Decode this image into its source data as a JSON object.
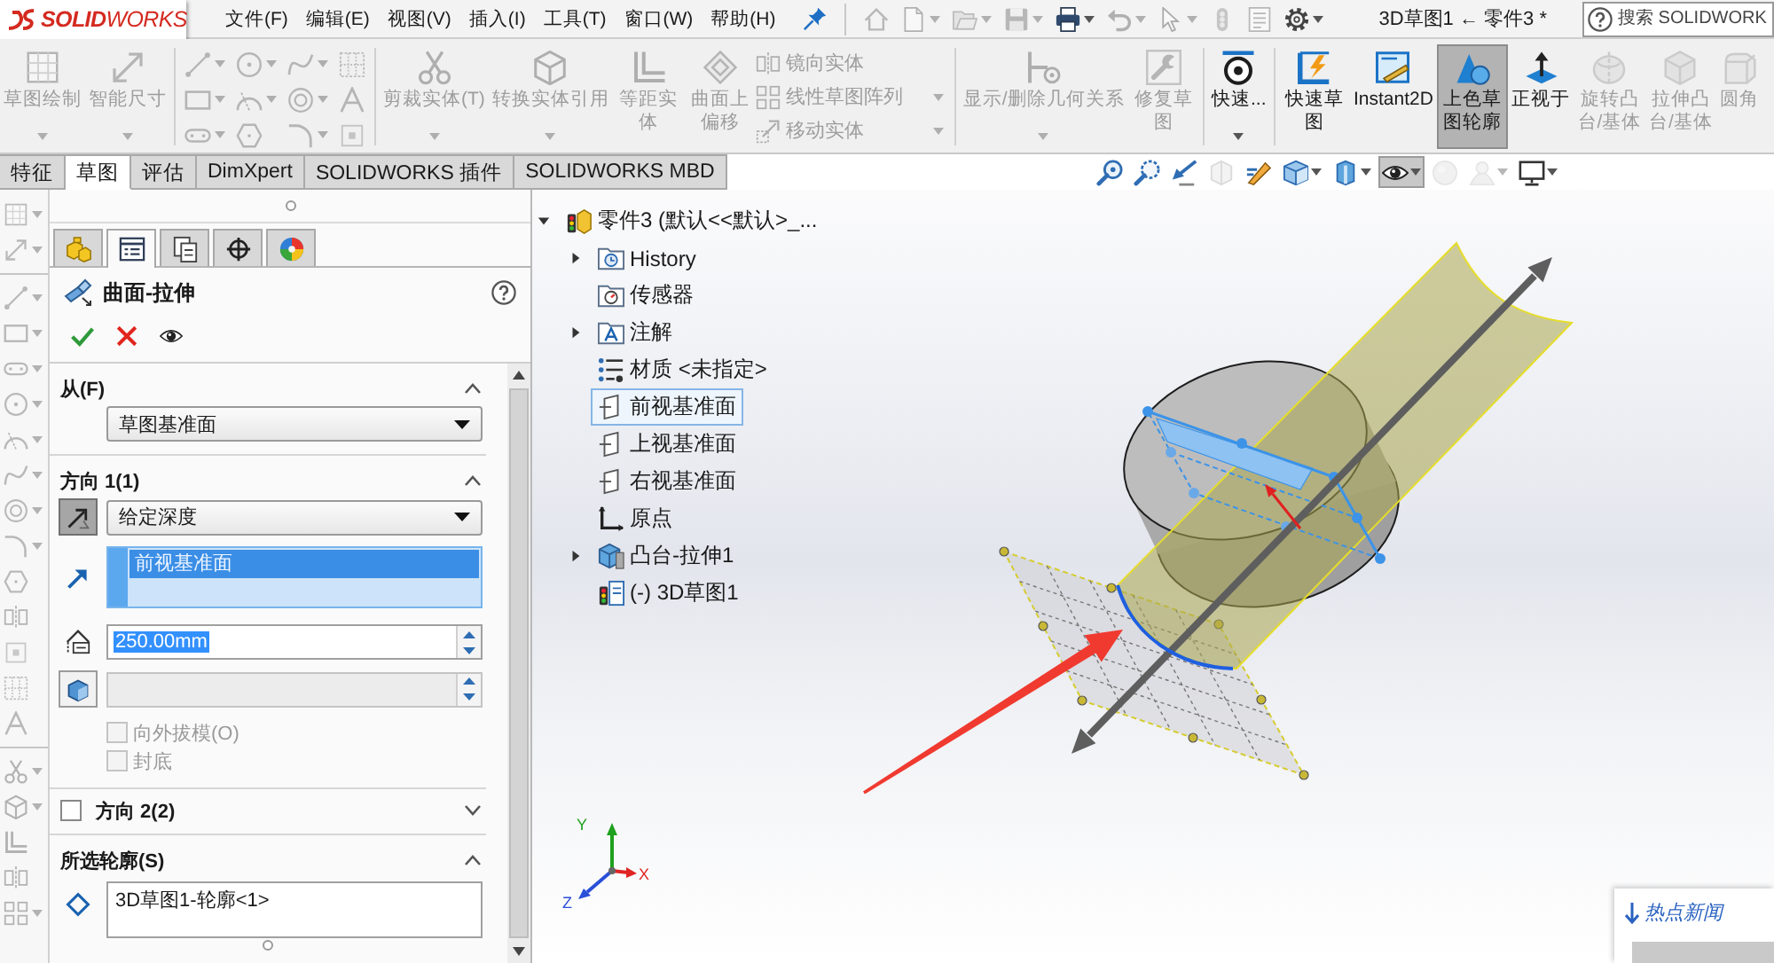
{
  "title_bar": {
    "logo": "**SOLID**WORKS",
    "menu": [
      "文件(F)",
      "编辑(E)",
      "视图(V)",
      "插入(I)",
      "工具(T)",
      "窗口(W)",
      "帮助(H)"
    ],
    "quick_access": [
      {
        "disabled": true,
        "dropdown": false
      },
      {
        "disabled": true,
        "dropdown": true
      },
      {
        "disabled": true,
        "dropdown": true
      },
      {
        "disabled": true,
        "dropdown": true
      },
      {
        "disabled": false,
        "dropdown": true
      },
      {
        "disabled": true,
        "dropdown": true
      },
      {
        "disabled": true,
        "dropdown": true
      },
      {
        "disabled": true,
        "dropdown": false
      },
      {
        "disabled": true,
        "dropdown": false
      },
      {
        "disabled": false,
        "dropdown": true
      }
    ],
    "document_title": "3D草图1 ← 零件3 *",
    "search": {
      "placeholder": "搜索 SOLIDWORK"
    }
  },
  "command_manager": {
    "groups": [
      {
        "kind": "buttons",
        "items": [
          {
            "kind": "large",
            "label": "草图绘制",
            "disabled": true,
            "selected": false,
            "dropdown": true
          },
          {
            "kind": "large",
            "label": "智能尺寸",
            "disabled": true,
            "selected": false,
            "dropdown": true
          }
        ]
      },
      {
        "kind": "grid",
        "items": [
          {
            "disabled": true,
            "dropdown": true
          },
          {
            "disabled": true,
            "dropdown": true
          },
          {
            "disabled": true,
            "dropdown": true
          },
          {
            "disabled": true,
            "dropdown": false
          },
          {
            "disabled": true,
            "dropdown": true
          },
          {
            "disabled": true,
            "dropdown": true
          },
          {
            "disabled": true,
            "dropdown": true
          },
          {
            "disabled": true,
            "dropdown": false
          },
          {
            "disabled": true,
            "dropdown": true
          },
          {
            "disabled": true,
            "dropdown": false
          },
          {
            "disabled": true,
            "dropdown": true
          },
          {
            "disabled": true,
            "dropdown": false
          }
        ]
      },
      {
        "kind": "buttons",
        "items": [
          {
            "kind": "large",
            "label": "剪裁实体(T)",
            "disabled": true,
            "selected": false,
            "dropdown": true
          },
          {
            "kind": "large",
            "label": "转换实体引用",
            "disabled": true,
            "selected": false,
            "dropdown": true
          },
          {
            "kind": "tall",
            "label": "等距实体",
            "disabled": true,
            "selected": false,
            "dropdown": false
          },
          {
            "kind": "tall",
            "label": "曲面上偏移",
            "disabled": true,
            "selected": false,
            "dropdown": false
          }
        ],
        "stack": [
          {
            "label": "镜向实体",
            "disabled": true,
            "dropdown": false
          },
          {
            "label": "线性草图阵列",
            "disabled": true,
            "dropdown": true
          },
          {
            "label": "移动实体",
            "disabled": true,
            "dropdown": true
          }
        ]
      },
      {
        "kind": "buttons",
        "items": [
          {
            "kind": "large",
            "label": "显示/删除几何关系",
            "disabled": true,
            "selected": false,
            "dropdown": true
          },
          {
            "kind": "tall",
            "label": "修复草图",
            "disabled": true,
            "selected": false,
            "dropdown": false
          }
        ]
      },
      {
        "kind": "buttons",
        "items": [
          {
            "kind": "large",
            "label": "快速...",
            "disabled": false,
            "selected": false,
            "dropdown": true
          }
        ]
      },
      {
        "kind": "buttons",
        "items": [
          {
            "kind": "tall",
            "label": "快速草图",
            "disabled": false,
            "selected": false,
            "dropdown": false
          },
          {
            "kind": "large",
            "label": "Instant2D",
            "disabled": false,
            "selected": false,
            "dropdown": false
          },
          {
            "kind": "tall",
            "label": "上色草图轮廓",
            "disabled": false,
            "selected": true,
            "dropdown": false
          },
          {
            "kind": "large",
            "label": "正视于",
            "disabled": false,
            "selected": false,
            "dropdown": false
          },
          {
            "kind": "tall",
            "label": "旋转凸台/基体",
            "disabled": true,
            "selected": false,
            "dropdown": false
          },
          {
            "kind": "tall",
            "label": "拉伸凸台/基体",
            "disabled": true,
            "selected": false,
            "dropdown": false
          },
          {
            "kind": "large",
            "label": "圆角",
            "disabled": true,
            "selected": false,
            "dropdown": false
          }
        ]
      }
    ]
  },
  "tabs": [
    {
      "label": "特征",
      "selected": false
    },
    {
      "label": "草图",
      "selected": true
    },
    {
      "label": "评估",
      "selected": false
    },
    {
      "label": "DimXpert",
      "selected": false
    },
    {
      "label": "SOLIDWORKS 插件",
      "selected": false
    },
    {
      "label": "SOLIDWORKS MBD",
      "selected": false
    }
  ],
  "view_toolbar": [
    {
      "disabled": false,
      "selected": false,
      "dropdown": false
    },
    {
      "disabled": false,
      "selected": false,
      "dropdown": false
    },
    {
      "disabled": false,
      "selected": false,
      "dropdown": false
    },
    {
      "disabled": true,
      "selected": false,
      "dropdown": false
    },
    {
      "disabled": false,
      "selected": false,
      "dropdown": false
    },
    {
      "disabled": false,
      "selected": false,
      "dropdown": true
    },
    {
      "disabled": false,
      "selected": false,
      "dropdown": true
    },
    {
      "disabled": false,
      "selected": true,
      "dropdown": true
    },
    {
      "disabled": true,
      "selected": false,
      "dropdown": false
    },
    {
      "disabled": true,
      "selected": false,
      "dropdown": true
    },
    {
      "disabled": false,
      "selected": false,
      "dropdown": true
    }
  ],
  "left_toolbar": {
    "disabled": true,
    "groups": [
      {
        "items": [
          {
            "dropdown": true
          },
          {
            "dropdown": true
          }
        ]
      },
      {
        "items": [
          {
            "dropdown": true
          },
          {
            "dropdown": true
          },
          {
            "dropdown": true
          },
          {
            "dropdown": true
          },
          {
            "dropdown": true
          },
          {
            "dropdown": true
          },
          {
            "dropdown": true
          },
          {
            "dropdown": true
          },
          {
            "dropdown": false
          },
          {
            "dropdown": false
          },
          {
            "dropdown": false
          },
          {
            "dropdown": false
          },
          {
            "dropdown": false
          }
        ]
      },
      {
        "items": [
          {
            "dropdown": true
          },
          {
            "dropdown": true
          },
          {
            "dropdown": false
          },
          {
            "dropdown": false
          },
          {
            "dropdown": true
          }
        ]
      }
    ]
  },
  "property_manager": {
    "tabs": [
      {
        "selected": false
      },
      {
        "selected": true
      },
      {
        "selected": false
      },
      {
        "selected": false
      },
      {
        "selected": false
      }
    ],
    "title": "曲面-拉伸",
    "from": {
      "label": "从(F)",
      "expanded": true,
      "value": "草图基准面"
    },
    "direction_1": {
      "label": "方向 1(1)",
      "expanded": true,
      "reverse_selected": true,
      "end_condition": "给定深度",
      "references": {
        "focused": true,
        "items": [
          {
            "label": "前视基准面",
            "selected": true
          }
        ]
      },
      "depth": {
        "value": "250.00mm",
        "selected": true
      },
      "draft": {
        "selected": false
      },
      "options": [
        {
          "label": "向外拔模(O)",
          "checked": false,
          "disabled": true
        },
        {
          "label": "封底",
          "checked": false,
          "disabled": true
        }
      ]
    },
    "direction_2": {
      "label": "方向 2(2)",
      "checked": false,
      "expanded": false
    },
    "contours": {
      "label": "所选轮廓(S)",
      "expanded": true,
      "items": [
        "3D草图1-轮廓<1>"
      ]
    }
  },
  "feature_tree": {
    "root": {
      "label": "零件3 (默认<<默认>_...",
      "expanded": true,
      "selected": false,
      "children": [
        {
          "label": "History",
          "expanded": false,
          "selected": false
        },
        {
          "label": "传感器",
          "selected": false
        },
        {
          "label": "注解",
          "expanded": false,
          "selected": false
        },
        {
          "label": "材质 <未指定>",
          "selected": false
        },
        {
          "label": "前视基准面",
          "selected": true
        },
        {
          "label": "上视基准面",
          "selected": false
        },
        {
          "label": "右视基准面",
          "selected": false
        },
        {
          "label": "原点",
          "selected": false
        },
        {
          "label": "凸台-拉伸1",
          "expanded": false,
          "selected": false
        },
        {
          "label": "(-) 3D草图1",
          "selected": false
        }
      ]
    }
  },
  "graphics": {
    "triad": {
      "x": "X",
      "y": "Y",
      "z": "Z"
    }
  },
  "news_widget": {
    "title": "热点新闻"
  }
}
